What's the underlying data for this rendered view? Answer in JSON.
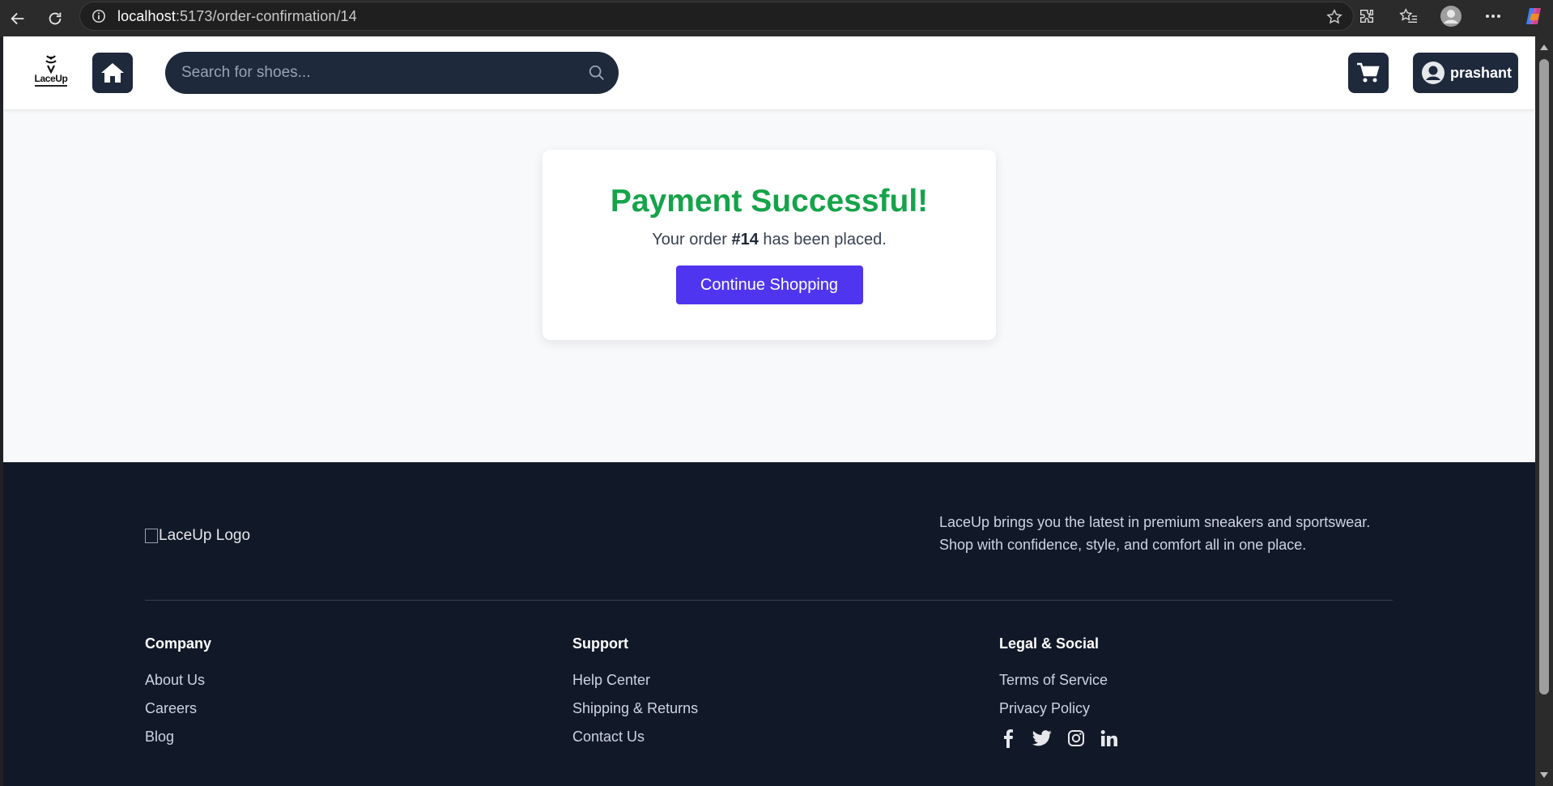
{
  "browser": {
    "url_host": "localhost",
    "url_path": ":5173/order-confirmation/14"
  },
  "header": {
    "logo_text": "LaceUp",
    "search_placeholder": "Search for shoes...",
    "username": "prashant"
  },
  "confirmation": {
    "title": "Payment Successful!",
    "message_prefix": "Your order ",
    "order_number": "#14",
    "message_suffix": " has been placed.",
    "button_label": "Continue Shopping",
    "title_color": "#16a34a",
    "button_color": "#4f35f0"
  },
  "footer": {
    "logo_alt": "LaceUp Logo",
    "about": "LaceUp brings you the latest in premium sneakers and sportswear. Shop with confidence, style, and comfort all in one place.",
    "columns": [
      {
        "heading": "Company",
        "links": [
          "About Us",
          "Careers",
          "Blog"
        ]
      },
      {
        "heading": "Support",
        "links": [
          "Help Center",
          "Shipping & Returns",
          "Contact Us"
        ]
      },
      {
        "heading": "Legal & Social",
        "links": [
          "Terms of Service",
          "Privacy Policy"
        ]
      }
    ],
    "social_icons": [
      "facebook-icon",
      "twitter-icon",
      "instagram-icon",
      "linkedin-icon"
    ]
  }
}
